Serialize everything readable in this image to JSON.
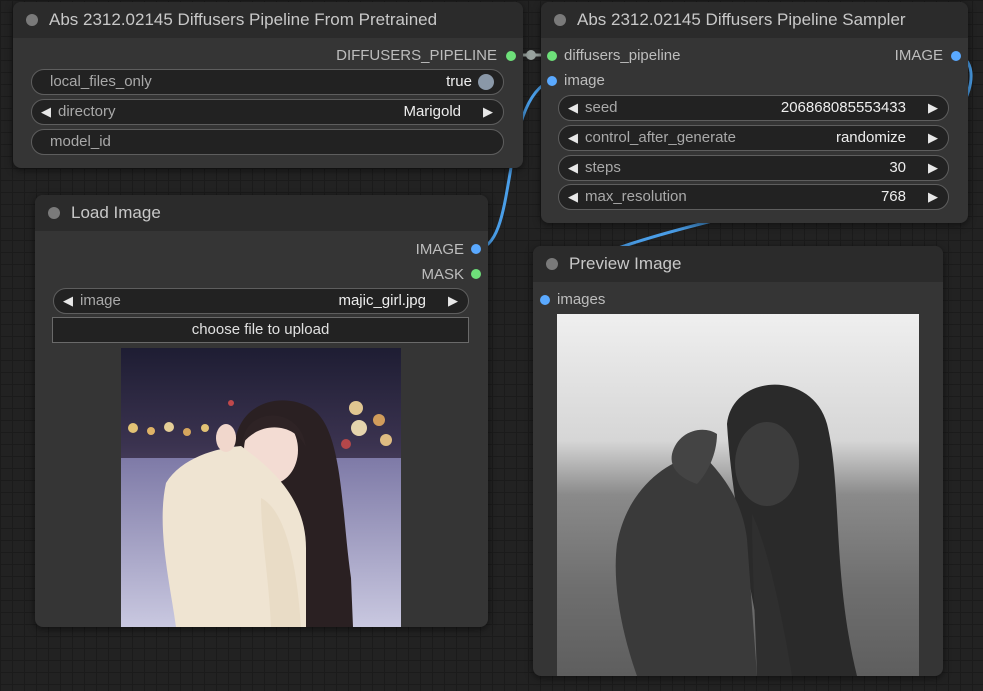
{
  "nodes": {
    "pretrained": {
      "title": "Abs 2312.02145 Diffusers Pipeline From Pretrained",
      "output": "DIFFUSERS_PIPELINE",
      "widgets": {
        "local_files_only": {
          "label": "local_files_only",
          "value": "true"
        },
        "directory": {
          "label": "directory",
          "value": "Marigold"
        },
        "model_id": {
          "label": "model_id",
          "value": ""
        }
      }
    },
    "sampler": {
      "title": "Abs 2312.02145 Diffusers Pipeline Sampler",
      "inputs": [
        "diffusers_pipeline",
        "image"
      ],
      "output": "IMAGE",
      "widgets": {
        "seed": {
          "label": "seed",
          "value": "206868085553433"
        },
        "control_after_generate": {
          "label": "control_after_generate",
          "value": "randomize"
        },
        "steps": {
          "label": "steps",
          "value": "30"
        },
        "max_resolution": {
          "label": "max_resolution",
          "value": "768"
        }
      }
    },
    "load_image": {
      "title": "Load Image",
      "outputs": [
        "IMAGE",
        "MASK"
      ],
      "widgets": {
        "image": {
          "label": "image",
          "value": "majic_girl.jpg"
        }
      },
      "upload_button": "choose file to upload"
    },
    "preview": {
      "title": "Preview Image",
      "input": "images"
    }
  },
  "colors": {
    "pipeline_link": "#6ee07a",
    "image_link": "#5aa9ff",
    "wire_blue": "#4a9ee8",
    "wire_gray": "#9aa4a0"
  },
  "icons": {
    "left_arrow": "◀",
    "right_arrow": "▶"
  }
}
